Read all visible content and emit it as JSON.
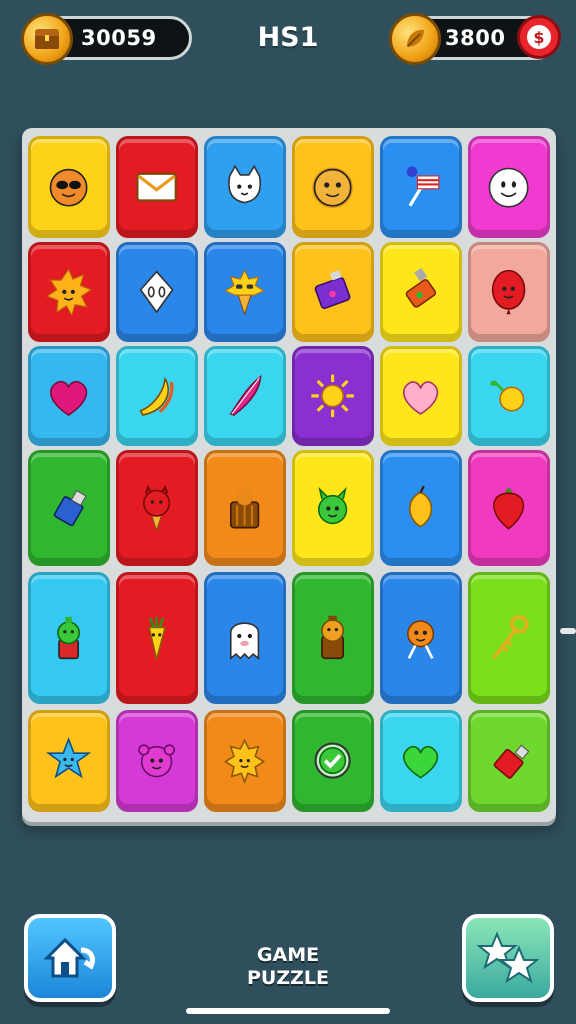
{
  "header": {
    "coins_left": "30059",
    "title": "HS1",
    "coins_right": "3800",
    "badge": "$"
  },
  "footer": {
    "caption_line1": "GAME",
    "caption_line2": "PUZZLE"
  },
  "grid": {
    "rows": 6,
    "cols": 6,
    "tiles": [
      {
        "color": "#ffd21a",
        "icon": "sunglasses-face"
      },
      {
        "color": "#e31b23",
        "icon": "envelope"
      },
      {
        "color": "#2f9ff0",
        "icon": "cat-face"
      },
      {
        "color": "#ffc21a",
        "icon": "lion-face"
      },
      {
        "color": "#2a8ff0",
        "icon": "lollipop-flag"
      },
      {
        "color": "#f03ad0",
        "icon": "smiley-face"
      },
      {
        "color": "#e31b23",
        "icon": "sun-face"
      },
      {
        "color": "#2a86e8",
        "icon": "mask-face"
      },
      {
        "color": "#2a86e8",
        "icon": "ice-cream-sun"
      },
      {
        "color": "#ffc21a",
        "icon": "candy-bar"
      },
      {
        "color": "#ffe61a",
        "icon": "paint-tube"
      },
      {
        "color": "#f2a89c",
        "icon": "red-balloon-face"
      },
      {
        "color": "#35b8f0",
        "icon": "heart"
      },
      {
        "color": "#3ad6f0",
        "icon": "banana"
      },
      {
        "color": "#3ad6f0",
        "icon": "pink-feather"
      },
      {
        "color": "#8a2fd0",
        "icon": "sun"
      },
      {
        "color": "#ffe61a",
        "icon": "pink-heart"
      },
      {
        "color": "#3ad6f0",
        "icon": "lemon"
      },
      {
        "color": "#2fb82f",
        "icon": "tube"
      },
      {
        "color": "#e31b23",
        "icon": "devil-ice-cream"
      },
      {
        "color": "#f28a1a",
        "icon": "basket"
      },
      {
        "color": "#ffe61a",
        "icon": "green-creature"
      },
      {
        "color": "#2a8ff0",
        "icon": "mango"
      },
      {
        "color": "#f03ac0",
        "icon": "strawberry"
      },
      {
        "color": "#35c8f0",
        "icon": "green-bottle"
      },
      {
        "color": "#e31b23",
        "icon": "carrot"
      },
      {
        "color": "#2a86e8",
        "icon": "ghost"
      },
      {
        "color": "#2fb82f",
        "icon": "jar-face"
      },
      {
        "color": "#2a86e8",
        "icon": "orange-creature"
      },
      {
        "color": "#7adf1a",
        "icon": "key"
      },
      {
        "color": "#ffc21a",
        "icon": "blue-star-face"
      },
      {
        "color": "#d63ad6",
        "icon": "purple-monster"
      },
      {
        "color": "#f28a1a",
        "icon": "orange-sun-face"
      },
      {
        "color": "#2fb82f",
        "icon": "check-badge"
      },
      {
        "color": "#3ad6f0",
        "icon": "green-heart"
      },
      {
        "color": "#6fd82f",
        "icon": "red-tube"
      }
    ]
  }
}
